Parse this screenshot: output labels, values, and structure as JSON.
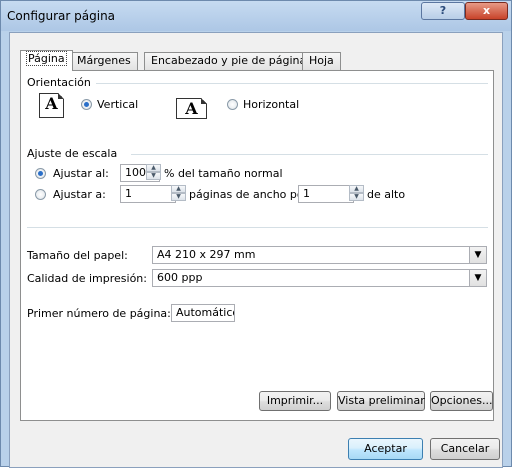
{
  "window": {
    "title": "Configurar página",
    "help_label": "?",
    "close_label": "x"
  },
  "tabs": [
    {
      "label": "Página"
    },
    {
      "label": "Márgenes"
    },
    {
      "label": "Encabezado y pie de página"
    },
    {
      "label": "Hoja"
    }
  ],
  "orientation": {
    "group_label": "Orientación",
    "vertical_label": "Vertical",
    "horizontal_label": "Horizontal",
    "icon_letter": "A",
    "selected": "vertical"
  },
  "scaling": {
    "group_label": "Ajuste de escala",
    "adjust_to_label": "Ajustar al:",
    "adjust_to_value": "100",
    "adjust_to_suffix": "% del tamaño normal",
    "fit_to_label": "Ajustar a:",
    "fit_wide_value": "1",
    "fit_wide_suffix": "páginas de ancho por",
    "fit_tall_value": "1",
    "fit_tall_suffix": "de alto",
    "selected": "adjust_to"
  },
  "paper": {
    "size_label": "Tamaño del papel:",
    "size_value": "A4 210 x 297 mm"
  },
  "quality": {
    "label": "Calidad de impresión:",
    "value": "600 ppp"
  },
  "first_page": {
    "label": "Primer número de página:",
    "value": "Automático"
  },
  "actions": {
    "print_label": "Imprimir...",
    "preview_label": "Vista preliminar",
    "options_label": "Opciones..."
  },
  "footer": {
    "ok_label": "Aceptar",
    "cancel_label": "Cancelar"
  }
}
